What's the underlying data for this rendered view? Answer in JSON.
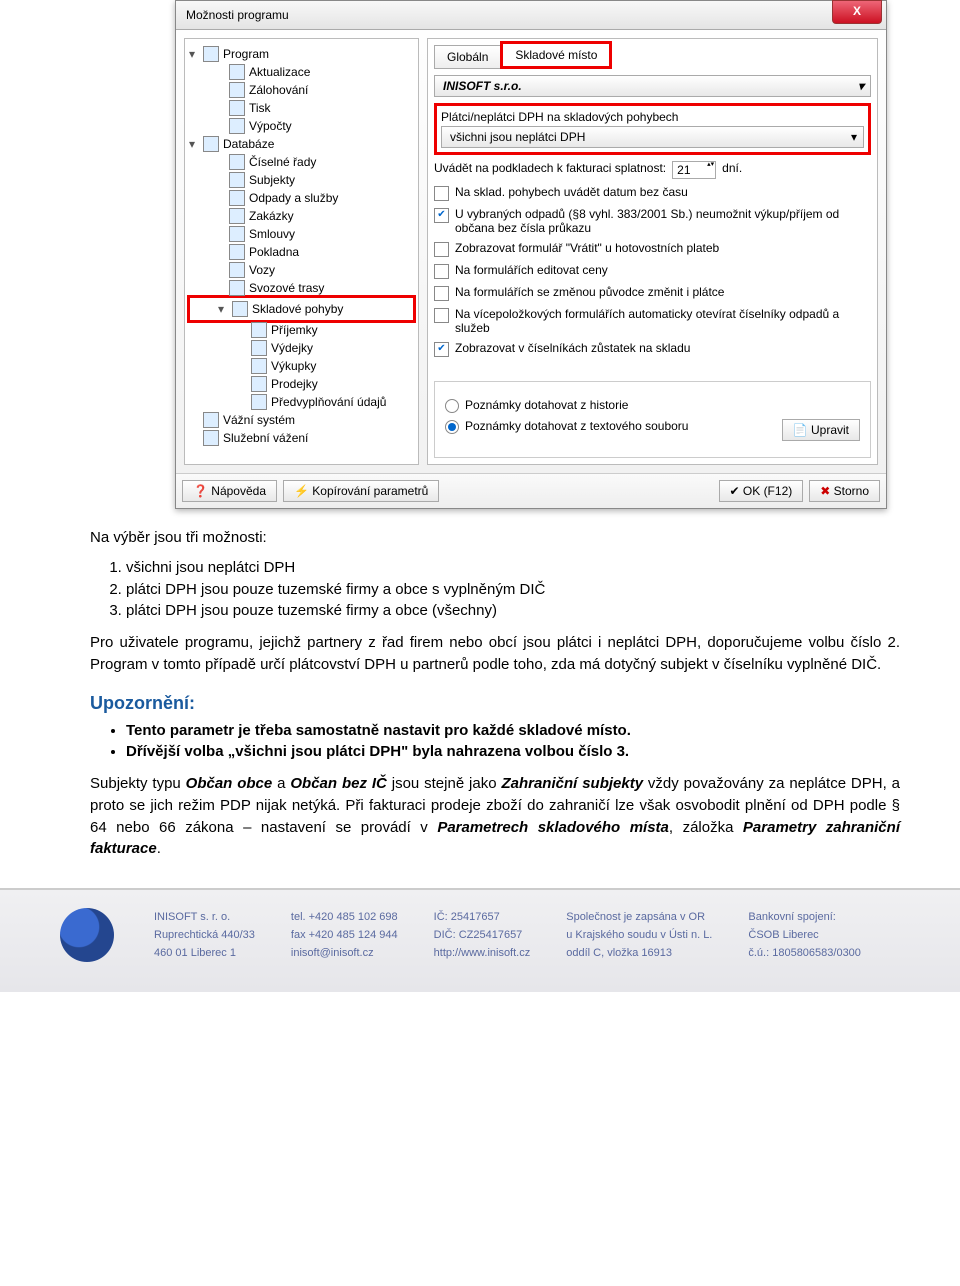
{
  "dialog": {
    "title": "Možnosti programu",
    "close": "X",
    "tree": {
      "items": [
        {
          "label": "Program",
          "exp": "▾",
          "ico": 1
        },
        {
          "label": "Aktualizace",
          "sub": 1,
          "ico": 1
        },
        {
          "label": "Zálohování",
          "sub": 1,
          "ico": 1
        },
        {
          "label": "Tisk",
          "sub": 1,
          "ico": 1
        },
        {
          "label": "Výpočty",
          "sub": 1,
          "ico": 1
        },
        {
          "label": "Databáze",
          "exp": "▾",
          "ico": 1
        },
        {
          "label": "Číselné řady",
          "sub": 1,
          "ico": 1
        },
        {
          "label": "Subjekty",
          "sub": 1,
          "ico": 1
        },
        {
          "label": "Odpady a služby",
          "sub": 1,
          "ico": 1
        },
        {
          "label": "Zakázky",
          "sub": 1,
          "ico": 1
        },
        {
          "label": "Smlouvy",
          "sub": 1,
          "ico": 1
        },
        {
          "label": "Pokladna",
          "sub": 1,
          "ico": 1
        },
        {
          "label": "Vozy",
          "sub": 1,
          "ico": 1
        },
        {
          "label": "Svozové trasy",
          "sub": 1,
          "ico": 1
        },
        {
          "label": "Skladové pohyby",
          "sub": 1,
          "exp": "▾",
          "hl": 1,
          "ico": 1
        },
        {
          "label": "Příjemky",
          "sub": 2,
          "ico": 1
        },
        {
          "label": "Výdejky",
          "sub": 2,
          "ico": 1
        },
        {
          "label": "Výkupky",
          "sub": 2,
          "ico": 1
        },
        {
          "label": "Prodejky",
          "sub": 2,
          "ico": 1
        },
        {
          "label": "Předvyplňování údajů",
          "sub": 2,
          "ico": 1
        },
        {
          "label": "Vážní systém",
          "ico": 1
        },
        {
          "label": "Služební vážení",
          "ico": 1
        }
      ]
    },
    "tabs": {
      "t1": "Globáln",
      "t2": "Skladové místo"
    },
    "company": "INISOFT s.r.o.",
    "grp": {
      "lbl": "Plátci/neplátci DPH na skladových pohybech",
      "val": "všichni jsou neplátci DPH"
    },
    "splat": {
      "pre": "Uvádět na podkladech k fakturaci splatnost:",
      "val": "21",
      "suf": "dní."
    },
    "checks": [
      {
        "c": 0,
        "t": "Na sklad. pohybech uvádět datum bez času"
      },
      {
        "c": 1,
        "t": "U vybraných odpadů (§8 vyhl. 383/2001 Sb.) neumožnit výkup/příjem od občana bez čísla průkazu"
      },
      {
        "c": 0,
        "t": "Zobrazovat formulář \"Vrátit\" u hotovostních plateb"
      },
      {
        "c": 0,
        "t": "Na formulářích editovat ceny"
      },
      {
        "c": 0,
        "t": "Na formulářích se změnou původce změnit i plátce"
      },
      {
        "c": 0,
        "t": "Na vícepoložkových formulářích automaticky otevírat číselníky odpadů a služeb"
      },
      {
        "c": 1,
        "t": "Zobrazovat v číselníkách zůstatek na skladu"
      }
    ],
    "radios": {
      "r1": "Poznámky dotahovat z historie",
      "r2": "Poznámky dotahovat z textového souboru",
      "edit": "Upravit"
    },
    "footer": {
      "help": "Nápověda",
      "copy": "Kopírování parametrů",
      "ok": "OK (F12)",
      "storno": "Storno"
    }
  },
  "doc": {
    "intro": "Na výběr jsou tři možnosti:",
    "opts": [
      "všichni jsou neplátci DPH",
      "plátci DPH jsou pouze tuzemské firmy a obce s vyplněným DIČ",
      "plátci DPH jsou pouze tuzemské firmy a obce (všechny)"
    ],
    "p1": "Pro uživatele programu, jejichž partnery z řad firem nebo obcí jsou plátci i neplátci DPH, doporučujeme volbu číslo 2. Program v tomto případě určí plátcovství DPH u partnerů podle toho, zda má dotyčný subjekt v číselníku vyplněné DIČ.",
    "warnTitle": "Upozornění:",
    "bul": [
      "Tento parametr je třeba samostatně nastavit pro každé skladové místo.",
      "Dřívější volba „všichni jsou plátci DPH\" byla nahrazena volbou číslo 3."
    ],
    "p2a": "Subjekty typu ",
    "p2b": "Občan obce",
    "p2c": " a ",
    "p2d": "Občan bez IČ",
    "p2e": " jsou stejně jako ",
    "p2f": "Zahraniční subjekty",
    "p2g": " vždy považovány za neplátce DPH, a proto se jich režim PDP nijak netýká. Při fakturaci prodeje zboží do zahraničí lze však osvobodit plnění od DPH podle § 64 nebo 66 zákona – nastavení se provádí v ",
    "p2h": "Parametrech skladového místa",
    "p2i": ", záložka ",
    "p2j": "Parametry zahraniční fakturace",
    "p2k": "."
  },
  "foot": {
    "c1": [
      "INISOFT s. r. o.",
      "Ruprechtická 440/33",
      "460 01  Liberec 1"
    ],
    "c2": [
      "tel. +420 485 102 698",
      "fax +420 485 124 944",
      "inisoft@inisoft.cz"
    ],
    "c3": [
      "IČ: 25417657",
      "DIČ: CZ25417657",
      "http://www.inisoft.cz"
    ],
    "c4": [
      "Společnost je zapsána v OR",
      "u Krajského soudu v Ústi n. L.",
      "oddíl C, vložka 16913"
    ],
    "c5": [
      "Bankovní spojení:",
      "ČSOB Liberec",
      "č.ú.: 1805806583/0300"
    ]
  }
}
